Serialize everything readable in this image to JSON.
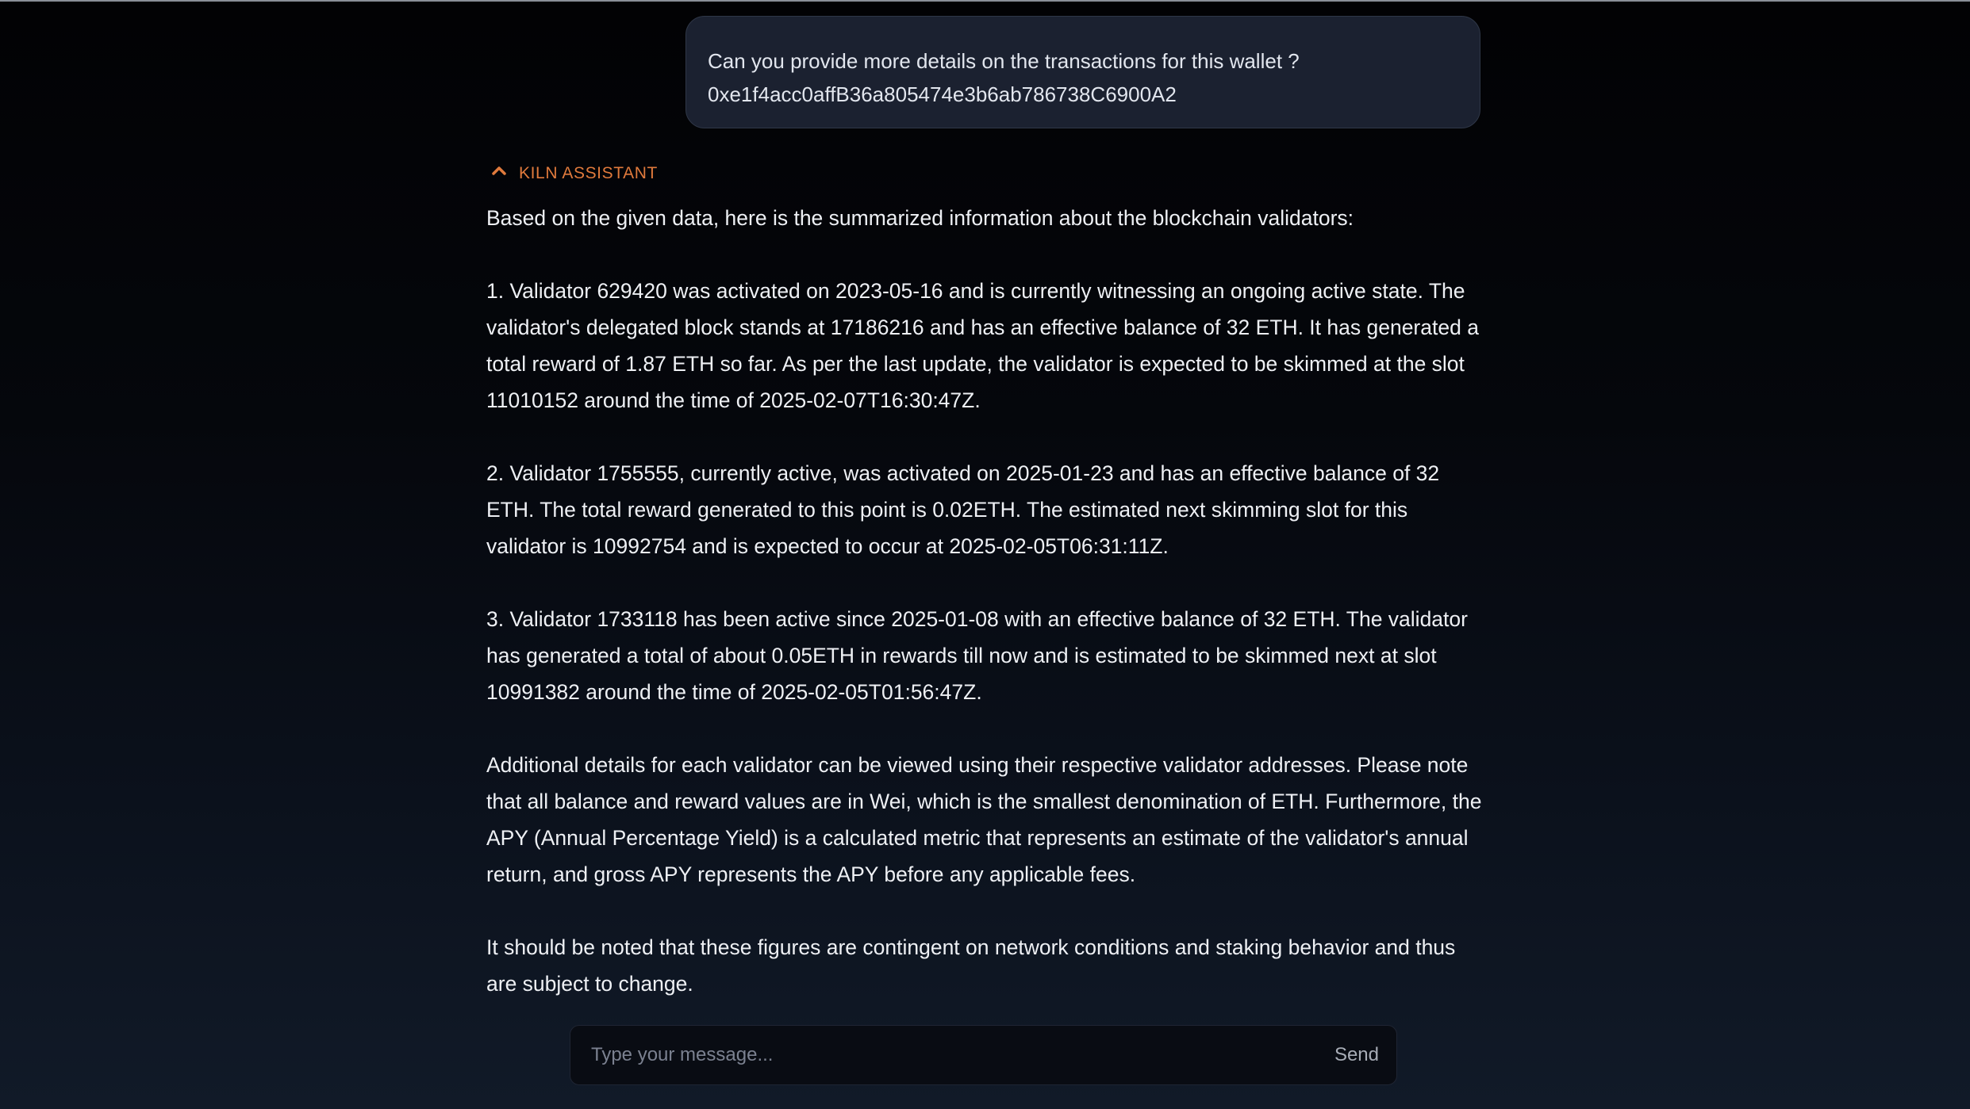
{
  "user_message": {
    "line1": "Can you provide more details on the transactions for this wallet ?",
    "line2": "0xe1f4acc0affB36a805474e3b6ab786738C6900A2"
  },
  "assistant": {
    "label": "KILN ASSISTANT",
    "icon": "kiln-chevron-icon",
    "accent_color": "#e07a3c",
    "paragraphs": [
      "Based on the given data, here is the summarized information about the blockchain validators:",
      "1. Validator 629420 was activated on 2023-05-16 and is currently witnessing an ongoing active state. The validator's delegated block stands at 17186216 and has an effective balance of 32 ETH. It has generated a total reward of 1.87 ETH so far. As per the last update, the validator is expected to be skimmed at the slot 11010152 around the time of 2025-02-07T16:30:47Z.",
      "2. Validator 1755555, currently active, was activated on 2025-01-23 and has an effective balance of 32 ETH. The total reward generated to this point is 0.02ETH. The estimated next skimming slot for this validator is 10992754 and is expected to occur at 2025-02-05T06:31:11Z.",
      "3. Validator 1733118 has been active since 2025-01-08 with an effective balance of 32 ETH. The validator has generated a total of about 0.05ETH in rewards till now and is estimated to be skimmed next at slot 10991382 around the time of 2025-02-05T01:56:47Z.",
      "Additional details for each validator can be viewed using their respective validator addresses. Please note that all balance and reward values are in Wei, which is the smallest denomination of ETH. Furthermore, the APY (Annual Percentage Yield) is a calculated metric that represents an estimate of the validator's annual return, and gross APY represents the APY before any applicable fees.",
      "It should be noted that these figures are contingent on network conditions and staking behavior and thus are subject to change."
    ]
  },
  "composer": {
    "placeholder": "Type your message...",
    "value": "",
    "send_label": "Send"
  }
}
